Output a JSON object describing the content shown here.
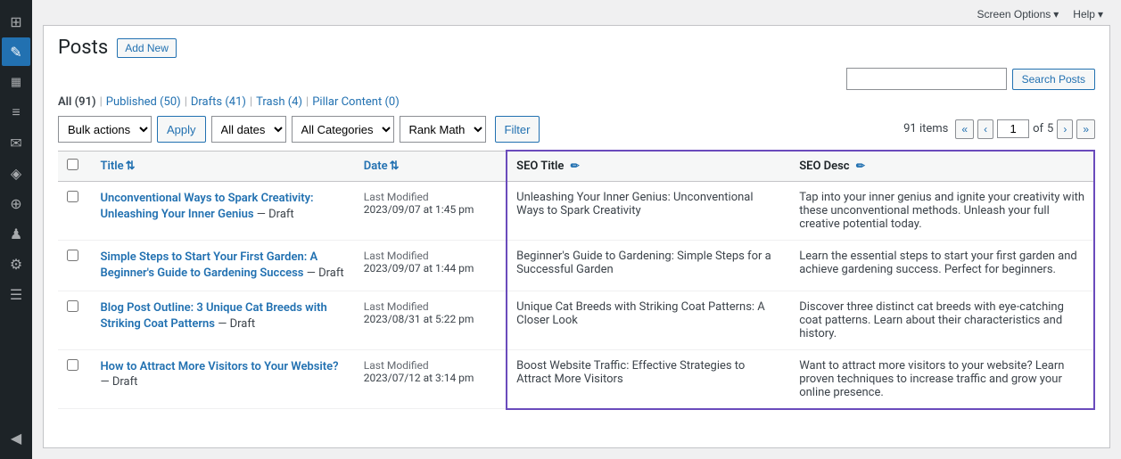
{
  "topbar": {
    "screen_options_label": "Screen Options",
    "help_label": "Help"
  },
  "page_header": {
    "title": "Posts",
    "add_new_label": "Add New"
  },
  "search": {
    "placeholder": "",
    "button_label": "Search Posts"
  },
  "filter_links": [
    {
      "label": "All",
      "count": "(91)",
      "active": true
    },
    {
      "label": "Published",
      "count": "(50)",
      "active": false
    },
    {
      "label": "Drafts",
      "count": "(41)",
      "active": false
    },
    {
      "label": "Trash",
      "count": "(4)",
      "active": false
    },
    {
      "label": "Pillar Content",
      "count": "(0)",
      "active": false
    }
  ],
  "toolbar": {
    "bulk_actions_label": "Bulk actions",
    "apply_label": "Apply",
    "dates_label": "All dates",
    "categories_label": "All Categories",
    "rank_math_label": "Rank Math",
    "filter_label": "Filter"
  },
  "pagination": {
    "items_count": "91 items",
    "current_page": "1",
    "total_pages": "5",
    "first_label": "«",
    "prev_label": "‹",
    "next_label": "›",
    "last_label": "»"
  },
  "table": {
    "col_title": "Title",
    "col_date": "Date",
    "col_seo_title": "SEO Title",
    "col_seo_desc": "SEO Desc",
    "rows": [
      {
        "title": "Unconventional Ways to Spark Creativity: Unleashing Your Inner Genius",
        "status": "Draft",
        "date_label": "Last Modified",
        "date_val": "2023/09/07 at 1:45 pm",
        "seo_title": "Unleashing Your Inner Genius: Unconventional Ways to Spark Creativity",
        "seo_desc": "Tap into your inner genius and ignite your creativity with these unconventional methods. Unleash your full creative potential today."
      },
      {
        "title": "Simple Steps to Start Your First Garden: A Beginner's Guide to Gardening Success",
        "status": "Draft",
        "date_label": "Last Modified",
        "date_val": "2023/09/07 at 1:44 pm",
        "seo_title": "Beginner's Guide to Gardening: Simple Steps for a Successful Garden",
        "seo_desc": "Learn the essential steps to start your first garden and achieve gardening success. Perfect for beginners."
      },
      {
        "title": "Blog Post Outline: 3 Unique Cat Breeds with Striking Coat Patterns",
        "status": "Draft",
        "date_label": "Last Modified",
        "date_val": "2023/08/31 at 5:22 pm",
        "seo_title": "Unique Cat Breeds with Striking Coat Patterns: A Closer Look",
        "seo_desc": "Discover three distinct cat breeds with eye-catching coat patterns. Learn about their characteristics and history."
      },
      {
        "title": "How to Attract More Visitors to Your Website?",
        "status": "Draft",
        "date_label": "Last Modified",
        "date_val": "2023/07/12 at 3:14 pm",
        "seo_title": "Boost Website Traffic: Effective Strategies to Attract More Visitors",
        "seo_desc": "Want to attract more visitors to your website? Learn proven techniques to increase traffic and grow your online presence."
      }
    ]
  },
  "sidebar": {
    "icons": [
      {
        "name": "dashboard-icon",
        "symbol": "⊞"
      },
      {
        "name": "posts-icon",
        "symbol": "✎",
        "active": true
      },
      {
        "name": "media-icon",
        "symbol": "🖼"
      },
      {
        "name": "pages-icon",
        "symbol": "📄"
      },
      {
        "name": "comments-icon",
        "symbol": "💬"
      },
      {
        "name": "appearance-icon",
        "symbol": "🎨"
      },
      {
        "name": "plugins-icon",
        "symbol": "🔌"
      },
      {
        "name": "users-icon",
        "symbol": "👤"
      },
      {
        "name": "tools-icon",
        "symbol": "🔧"
      },
      {
        "name": "settings-icon",
        "symbol": "⚙"
      },
      {
        "name": "collapse-icon",
        "symbol": "◀"
      }
    ]
  }
}
